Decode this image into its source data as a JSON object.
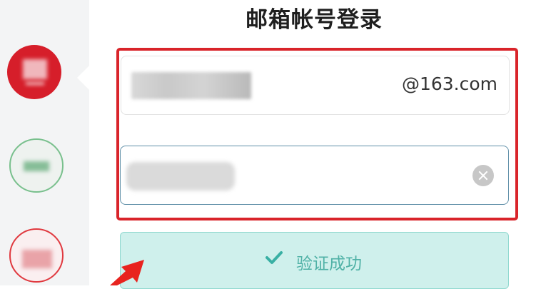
{
  "title": "邮箱帐号登录",
  "account": {
    "suffix": "@163.com"
  },
  "status": {
    "label": "验证成功"
  },
  "icons": {
    "clear": "clear-icon",
    "check": "check-icon",
    "arrow": "arrow-icon"
  },
  "colors": {
    "highlight": "#d9242a",
    "success_bg": "#cff0ec",
    "success_text": "#4fb1a6"
  }
}
